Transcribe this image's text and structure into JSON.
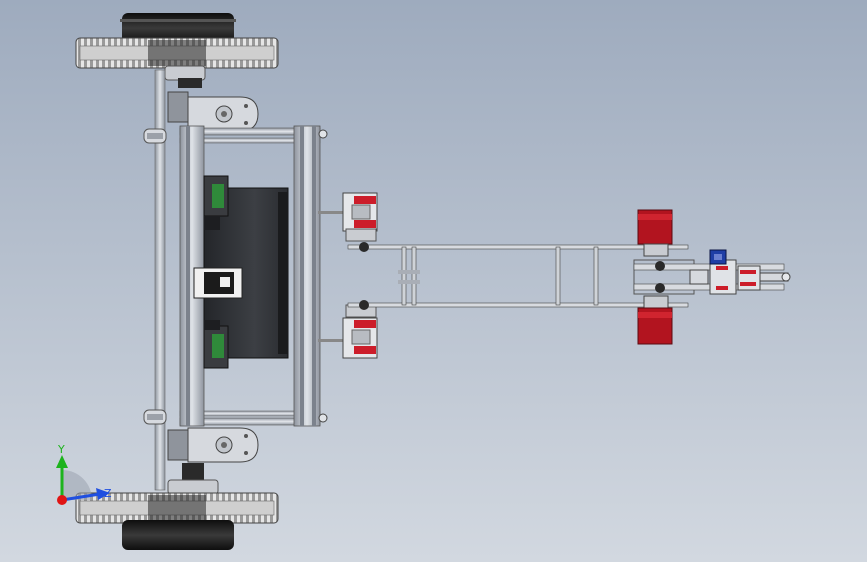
{
  "viewport": {
    "background_top": "#9eabbe",
    "background_bottom": "#d2d8e0"
  },
  "triad": {
    "y_label": "Y",
    "z_label": "Z",
    "y_color": "#1db31d",
    "z_color": "#1f4fe0",
    "x_color": "#e01414"
  },
  "model": {
    "wheel_tread_color": "#d8d8d8",
    "hub_color": "#1c1c1c",
    "frame_color": "#b9bec7",
    "panel_color": "#303236",
    "servo_red": "#cc1d2a",
    "motor_red": "#b2141f",
    "motor_blue": "#1f3ea6",
    "pcb_green": "#2f8a3a"
  }
}
